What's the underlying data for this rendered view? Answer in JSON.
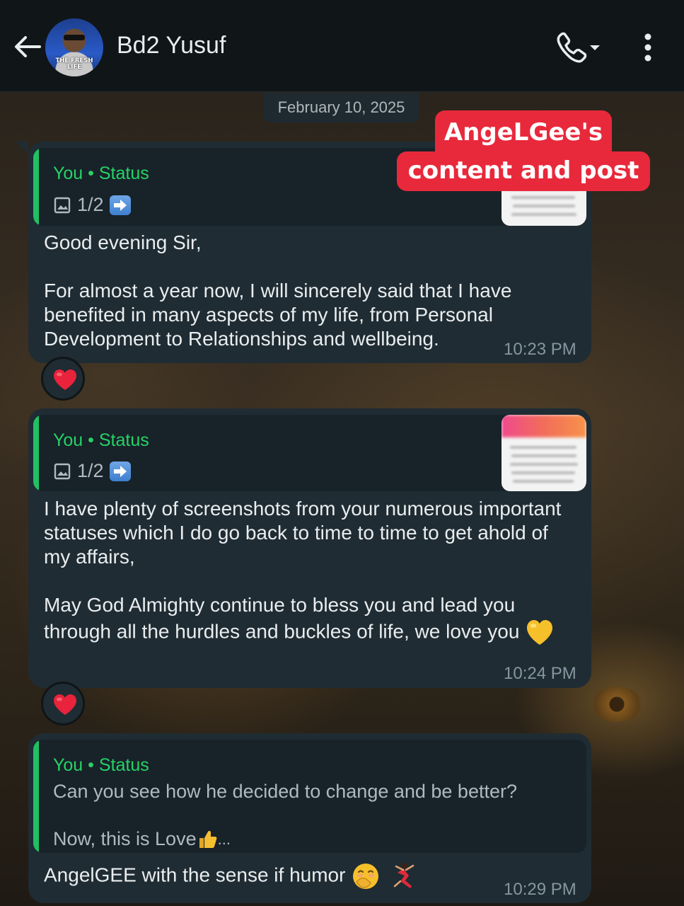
{
  "header": {
    "contact_name": "Bd2 Yusuf",
    "avatar_text_top": "THE FRESH",
    "avatar_text_bottom": "LIFE"
  },
  "date_chip": "February 10, 2025",
  "overlay": {
    "line1": "AngeLGee's",
    "line2": "content and post"
  },
  "messages": [
    {
      "quote_author": "You",
      "quote_source": "Status",
      "quote_meta": "1/2",
      "text": "Good evening Sir,\n\nFor almost a year now, I will sincerely said that I have benefited in many aspects of my life, from Personal Development to Relationships and wellbeing.",
      "time": "10:23 PM",
      "reaction": "red-heart"
    },
    {
      "quote_author": "You",
      "quote_source": "Status",
      "quote_meta": "1/2",
      "text_part1": "I have plenty of screenshots from your numerous important statuses which I do go back to time to time to get ahold of my affairs,\n\nMay God Almighty continue to bless you and lead you",
      "text_part2": "through all the hurdles and buckles of life, we love you",
      "time": "10:24 PM",
      "reaction": "red-heart"
    },
    {
      "quote_author": "You",
      "quote_source": "Status",
      "quote_line1": "Can you see how he decided to change and be better?",
      "quote_line2": "Now, this is Love",
      "quote_ellipsis": "...",
      "text": "AngelGEE with the sense if humor",
      "time": "10:29 PM"
    }
  ],
  "colors": {
    "accent_green": "#25d366",
    "bubble": "#1f2c33",
    "overlay_red": "#e8293b"
  }
}
